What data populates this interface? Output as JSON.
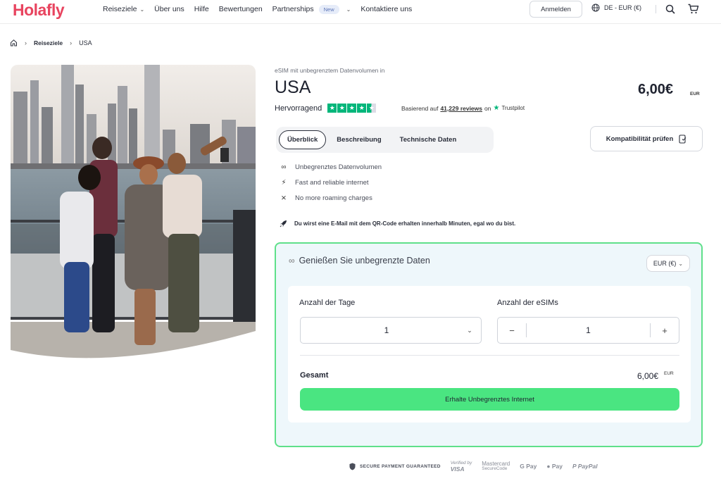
{
  "colors": {
    "brand": "#e8445f",
    "accent_green": "#4ae581",
    "card_border": "#5fe08a",
    "trustpilot": "#00b67a"
  },
  "header": {
    "logo": "Holafly",
    "nav": [
      {
        "label": "Reiseziele",
        "has_dropdown": true
      },
      {
        "label": "Über uns"
      },
      {
        "label": "Hilfe"
      },
      {
        "label": "Bewertungen"
      },
      {
        "label": "Partnerships",
        "badge": "New",
        "has_dropdown": true
      },
      {
        "label": "Kontaktiere uns"
      }
    ],
    "login_label": "Anmelden",
    "language_label": "DE - EUR (€)",
    "icons": [
      "globe-icon",
      "search-icon",
      "cart-icon"
    ]
  },
  "breadcrumb": {
    "home_icon": "home-icon",
    "items": [
      "Reiseziele",
      "USA"
    ]
  },
  "product": {
    "subtitle": "eSIM mit unbegrenztem Datenvolumen in",
    "title": "USA",
    "price": "6,00€",
    "price_currency": "EUR",
    "rating_label": "Hervorragend",
    "rating_stars": 4.5,
    "reviews_prefix": "Basierend auf",
    "reviews_count": "41,229 reviews",
    "reviews_on": "on",
    "reviews_source": "Trustpilot"
  },
  "tabs": [
    {
      "label": "Überblick",
      "active": true
    },
    {
      "label": "Beschreibung"
    },
    {
      "label": "Technische Daten"
    }
  ],
  "compat_button": "Kompatibilität prüfen",
  "features": [
    {
      "icon": "infinity-icon",
      "text": "Unbegrenztes Datenvolumen"
    },
    {
      "icon": "bolt-icon",
      "text": "Fast and reliable internet"
    },
    {
      "icon": "no-roaming-icon",
      "text": "No more roaming charges"
    }
  ],
  "notice": {
    "icon": "rocket-icon",
    "text": "Du wirst eine E-Mail mit dem QR-Code erhalten innerhalb Minuten, egal wo du bist."
  },
  "plan": {
    "heading": "Genießen Sie unbegrenzte Daten",
    "currency_select": "EUR (€)",
    "days_label": "Anzahl der Tage",
    "days_value": "1",
    "esims_label": "Anzahl der eSIMs",
    "esims_value": "1",
    "minus": "−",
    "plus": "+",
    "total_label": "Gesamt",
    "total_value": "6,00€",
    "total_currency": "EUR",
    "cta": "Erhalte Unbegrenztes Internet"
  },
  "payment": {
    "secure_label": "SECURE PAYMENT GUARANTEED",
    "verified_top": "Verified by",
    "verified_bottom": "VISA",
    "mastercard_top": "Mastercard",
    "mastercard_bottom": "SecureCode",
    "gpay": "G Pay",
    "applepay": "Pay",
    "paypal": "PayPal"
  }
}
